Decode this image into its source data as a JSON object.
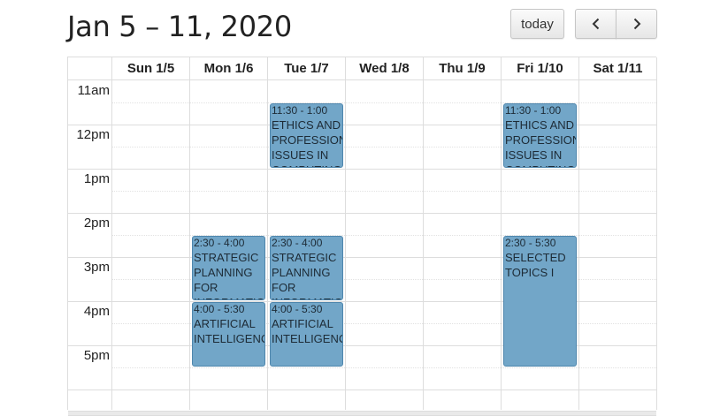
{
  "header": {
    "title": "Jan 5 – 11, 2020",
    "today_label": "today"
  },
  "days": [
    "Sun 1/5",
    "Mon 1/6",
    "Tue 1/7",
    "Wed 1/8",
    "Thu 1/9",
    "Fri 1/10",
    "Sat 1/11"
  ],
  "times": [
    "11am",
    "12pm",
    "1pm",
    "2pm",
    "3pm",
    "4pm",
    "5pm"
  ],
  "events": [
    {
      "day": 2,
      "start": "11:30",
      "end": "1:00",
      "time": "11:30 - 1:00",
      "title": "ETHICS AND PROFESSIONAL ISSUES IN COMPUTING"
    },
    {
      "day": 5,
      "start": "11:30",
      "end": "1:00",
      "time": "11:30 - 1:00",
      "title": "ETHICS AND PROFESSIONAL ISSUES IN COMPUTING"
    },
    {
      "day": 1,
      "start": "2:30",
      "end": "4:00",
      "time": "2:30 - 4:00",
      "title": "STRATEGIC PLANNING FOR INFORMATION"
    },
    {
      "day": 2,
      "start": "2:30",
      "end": "4:00",
      "time": "2:30 - 4:00",
      "title": "STRATEGIC PLANNING FOR INFORMATION"
    },
    {
      "day": 1,
      "start": "4:00",
      "end": "5:30",
      "time": "4:00 - 5:30",
      "title": "ARTIFICIAL INTELLIGENCE"
    },
    {
      "day": 2,
      "start": "4:00",
      "end": "5:30",
      "time": "4:00 - 5:30",
      "title": "ARTIFICIAL INTELLIGENCE"
    },
    {
      "day": 5,
      "start": "2:30",
      "end": "5:30",
      "time": "2:30 - 5:30",
      "title": "SELECTED TOPICS I"
    }
  ],
  "colors": {
    "event_bg": "#72a6c8",
    "event_border": "#4e86ad",
    "grid_line": "#dddddd"
  },
  "icons": {
    "prev": "chevron-left-icon",
    "next": "chevron-right-icon"
  }
}
